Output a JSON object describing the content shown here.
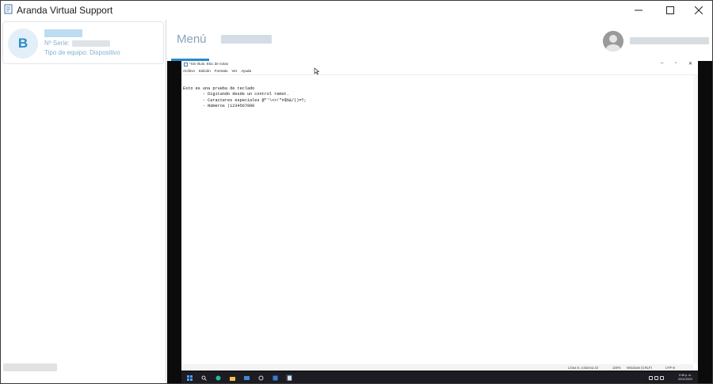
{
  "window": {
    "title": "Aranda Virtual Support"
  },
  "device": {
    "avatar_letter": "B",
    "serial_label": "Nº Serie:",
    "type_label": "Tipo de equipo: Dispositivo"
  },
  "header": {
    "menu_label": "Menú"
  },
  "notepad": {
    "title": "*Sin título: Bloc de notas",
    "menu": [
      "Archivo",
      "Edición",
      "Formato",
      "Ver",
      "Ayuda"
    ],
    "lines": [
      "Esto es una prueba de teclado",
      "\t- Digitando desde un control remot.",
      "\t- Caracteres especiales @\"'\\<>!\"#$%&/()=?;",
      "\t- Números |1234567890"
    ],
    "status": {
      "position": "Línea 6, columna 23",
      "zoom": "100%",
      "line_ending": "Windows (CRLF)",
      "encoding": "UTF-8"
    }
  },
  "taskbar": {
    "time": "2:46 p. m.",
    "date": "22/11/2023",
    "icons": [
      "windows-start-icon",
      "search-icon",
      "edge-icon",
      "file-explorer-icon",
      "mail-icon",
      "settings-icon",
      "snipping-tool-icon",
      "notepad-icon"
    ]
  },
  "colors": {
    "accent": "#2a8acb",
    "muted_text": "#8aa3b7",
    "avatar_bg": "#e2eff8",
    "remote_bg": "#0b0b0b",
    "taskbar_bg": "#1c1c22"
  }
}
